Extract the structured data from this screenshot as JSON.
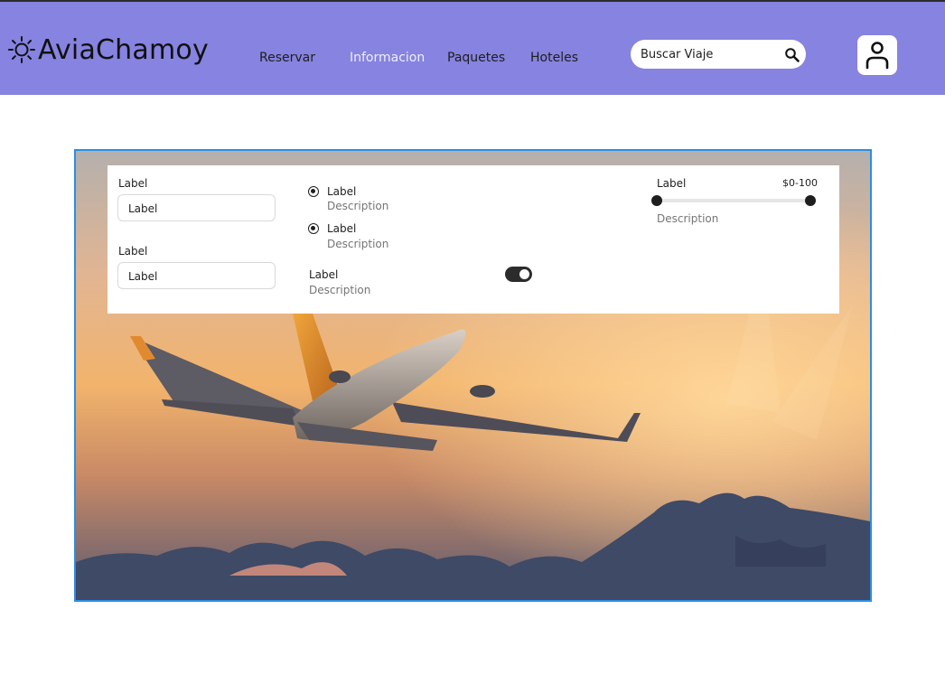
{
  "brand": {
    "name": "AviaChamoy",
    "icon": "sun-icon"
  },
  "nav": {
    "items": [
      {
        "label": "Reservar",
        "active": false
      },
      {
        "label": "Informacion",
        "active": true
      },
      {
        "label": "Paquetes",
        "active": false
      },
      {
        "label": "Hoteles",
        "active": false
      }
    ]
  },
  "search": {
    "value": "Buscar Viaje",
    "icon": "search-icon"
  },
  "user": {
    "icon": "user-icon"
  },
  "colors": {
    "navbar": "#8783e0",
    "hero_border": "#2a8ee4",
    "toggle_on": "#2c2c2c",
    "muted_text": "#757575"
  },
  "filters": {
    "inputs": [
      {
        "label": "Label",
        "value": "Label"
      },
      {
        "label": "Label",
        "value": "Label"
      }
    ],
    "radios": [
      {
        "label": "Label",
        "description": "Description",
        "checked": true
      },
      {
        "label": "Label",
        "description": "Description",
        "checked": true
      }
    ],
    "toggle": {
      "label": "Label",
      "description": "Description",
      "on": true
    },
    "range": {
      "label": "Label",
      "value_text": "$0-100",
      "description": "Description",
      "min_fraction": 0.0,
      "max_fraction": 1.0
    }
  },
  "hero": {
    "image": "airplane flying at sunset"
  }
}
